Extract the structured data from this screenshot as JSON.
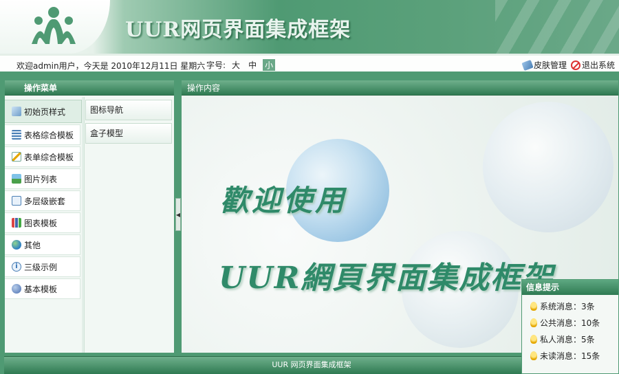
{
  "header": {
    "title": "UUR网页界面集成框架"
  },
  "infobar": {
    "welcome": "欢迎admin用户，今天是 2010年12月11日 星期六",
    "fontsize_label": "字号:",
    "fontsize_options": [
      "大",
      "中",
      "小"
    ],
    "skin_label": "皮肤管理",
    "logout_label": "退出系统"
  },
  "left": {
    "title": "操作菜单",
    "menu": [
      {
        "label": "初始页样式",
        "icon": "brush-icon"
      },
      {
        "label": "表格综合模板",
        "icon": "table-icon"
      },
      {
        "label": "表单综合模板",
        "icon": "form-edit-icon"
      },
      {
        "label": "图片列表",
        "icon": "picture-icon"
      },
      {
        "label": "多层级嵌套",
        "icon": "document-icon"
      },
      {
        "label": "图表模板",
        "icon": "bar-chart-icon"
      },
      {
        "label": "其他",
        "icon": "globe-icon"
      },
      {
        "label": "三级示例",
        "icon": "info-icon"
      },
      {
        "label": "基本模板",
        "icon": "help-icon"
      }
    ],
    "submenu": [
      "图标导航",
      "盒子模型"
    ]
  },
  "main": {
    "title": "操作内容",
    "welcome": "歡迎使用",
    "brand": "UUR網頁界面集成框架"
  },
  "footer": {
    "text": "UUR 网页界面集成框架"
  },
  "notify": {
    "title": "信息提示",
    "items": [
      "系统消息：3条",
      "公共消息：10条",
      "私人消息：5条",
      "未读消息：15条"
    ]
  },
  "colors": {
    "brand_green": "#4f9a73",
    "dark_green": "#2f7a52",
    "text_green": "#2f8a69"
  }
}
